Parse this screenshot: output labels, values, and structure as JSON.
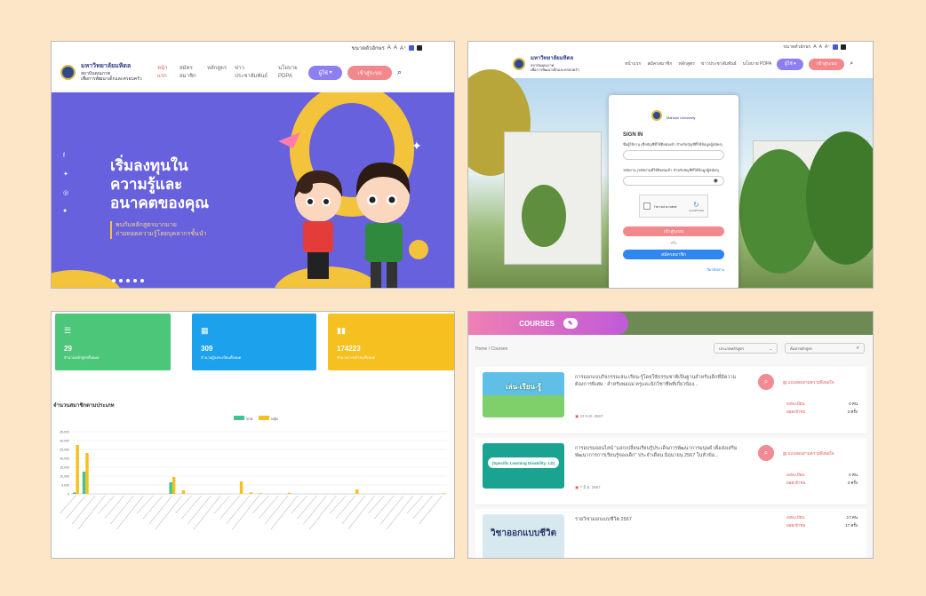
{
  "panel1": {
    "topstrip": {
      "font_label": "ขนาดตัวอักษร",
      "font_small": "A",
      "font_mid": "A",
      "font_big": "A⁺"
    },
    "university": {
      "name": "มหาวิทยาลัยมหิดล",
      "line1": "สถาบันคุณภาพ",
      "line2": "เพื่อการพัฒนาเด็กและครอบครัว"
    },
    "nav": [
      {
        "label": "หน้าแรก",
        "active": true
      },
      {
        "label": "สมัครสมาชิก",
        "active": false
      },
      {
        "label": "หลักสูตร",
        "active": false
      },
      {
        "label": "ข่าวประชาสัมพันธ์",
        "active": false
      },
      {
        "label": "นโยบาย PDPA",
        "active": false
      }
    ],
    "lang_button": "ผู้ใช้",
    "login_button": "เข้าสู่ระบบ",
    "hero": {
      "title_1": "เริ่มลงทุนใน",
      "title_2": "ความรู้และ",
      "title_3": "อนาคตของคุณ",
      "sub_1": "พบกับหลักสูตรมากมาย",
      "sub_2": "ถ่ายทอดความรู้โดยบุคลากรชั้นนำ"
    },
    "social_icons": [
      "facebook-icon",
      "twitter-icon",
      "instagram-icon",
      "line-icon"
    ]
  },
  "panel2": {
    "nav": [
      "หน้าแรก",
      "สมัครสมาชิก",
      "หลักสูตร",
      "ข่าวประชาสัมพันธ์",
      "นโยบาย PDPA"
    ],
    "lang_button": "ผู้ใช้",
    "login_button": "เข้าสู่ระบบ",
    "card": {
      "logo_caption": "Mahidol University",
      "heading": "SIGN IN",
      "user_label": "ชื่อผู้ใช้งาน (ชื่อบัญชีที่ใช้ติดต่อเข้า สำหรับบัญชีที่ใช้ข้อมูลผู้สมัคร)",
      "pass_label": "รหัสผ่าน (รหัสผ่านที่ใช้ติดต่อเข้า สำหรับบัญชีที่ใช้ข้อมูลผู้สมัคร)",
      "captcha_label": "I'm not a robot",
      "captcha_brand": "reCAPTCHA",
      "login_button": "เข้าสู่ระบบ",
      "or_text": "หรือ",
      "register_button": "สมัครสมาชิก",
      "forgot": "ลืมรหัสผ่าน"
    }
  },
  "panel3": {
    "stats": [
      {
        "value": "29",
        "caption": "จำนวนหลักสูตรทั้งหมด",
        "color": "#4cc779"
      },
      {
        "value": "309",
        "caption": "จำนวนผู้ลงทะเบียนทั้งหมด",
        "color": "#1ca1ec"
      },
      {
        "value": "174223",
        "caption": "จำนวนการเข้าชมทั้งหมด",
        "color": "#f6c020"
      }
    ],
    "chart_title": "จำนวนสมาชิกตามประเภท"
  },
  "chart_data": {
    "type": "bar",
    "title": "จำนวนสมาชิกตามประเภท",
    "ylim": [
      0,
      35000
    ],
    "yticks": [
      "0",
      "5,000",
      "10,000",
      "15,000",
      "20,000",
      "25,000",
      "30,000",
      "35,000"
    ],
    "grid": true,
    "legend_position": "top-center",
    "series": [
      {
        "name": "ชาย",
        "color": "#43c38e",
        "values": [
          800,
          12500,
          0,
          0,
          0,
          0,
          0,
          0,
          0,
          0,
          6500,
          0,
          0,
          0,
          0,
          0,
          0,
          0,
          0,
          0,
          0,
          0,
          0,
          0,
          0,
          0,
          0,
          0,
          0,
          0,
          0,
          0,
          0,
          0,
          0,
          0,
          0,
          0,
          0
        ]
      },
      {
        "name": "หญิง",
        "color": "#f6c020",
        "values": [
          27500,
          23000,
          0,
          0,
          0,
          0,
          0,
          0,
          0,
          0,
          9500,
          2000,
          0,
          0,
          0,
          0,
          0,
          7000,
          800,
          400,
          0,
          0,
          600,
          0,
          0,
          0,
          0,
          0,
          0,
          2500,
          0,
          0,
          0,
          0,
          0,
          0,
          0,
          0,
          300
        ]
      }
    ]
  },
  "panel4": {
    "banner": "COURSES",
    "breadcrumb": "Home / Courses",
    "category_select": "ประเภทหลักสูตร",
    "search_placeholder": "ค้นหาหลักสูตร",
    "courses": [
      {
        "title": "การออกแบบกิจกรรมเล่น-เรียน-รู้โดยใช้ธรรมชาติเป็นฐานสำหรับเด็กที่มีความต้องการพิเศษ : สำหรับพ่อแม่ ครูและนักวิชาชีพที่เกี่ยวข้อง...",
        "date": "23 พ.ค. 2567",
        "qr": "แบบสอบถามความพึงพอใจ",
        "enrolled_label": "ลงทะเบียน",
        "enrolled": "0",
        "enrolled_unit": "คน",
        "views_label": "ยอดเข้าชม",
        "views": "3",
        "views_unit": "ครั้ง",
        "thumb_text": "เล่น-เรียน-รู้",
        "thumb_color": "#7fcf6a"
      },
      {
        "title": "การอบรมออนไลน์ \"แลกเปลี่ยนเรียนรู้ประเด็นการพัฒนาการมนุษย์ เพื่อส่งเสริมพัฒนาการการเรียนรู้ของเด็ก\" ประจำเดือน มิถุนายน 2567 ในหัวข้อ...",
        "date": "7 มิ.ย. 2567",
        "qr": "แบบสอบถามความพึงพอใจ",
        "enrolled_label": "ลงทะเบียน",
        "enrolled": "0",
        "enrolled_unit": "คน",
        "views_label": "ยอดเข้าชม",
        "views": "3",
        "views_unit": "ครั้ง",
        "thumb_text": "(Specific Learning Disability: LD)",
        "thumb_color": "#1aa391"
      },
      {
        "title": "รายวิชาออกแบบชีวิต 2567",
        "date": "",
        "qr": "",
        "enrolled_label": "ลงทะเบียน",
        "enrolled": "17",
        "enrolled_unit": "คน",
        "views_label": "ยอดเข้าชม",
        "views": "17",
        "views_unit": "ครั้ง",
        "thumb_text": "วิชาออกแบบชีวิต",
        "thumb_color": "#d7e8ef"
      }
    ]
  }
}
